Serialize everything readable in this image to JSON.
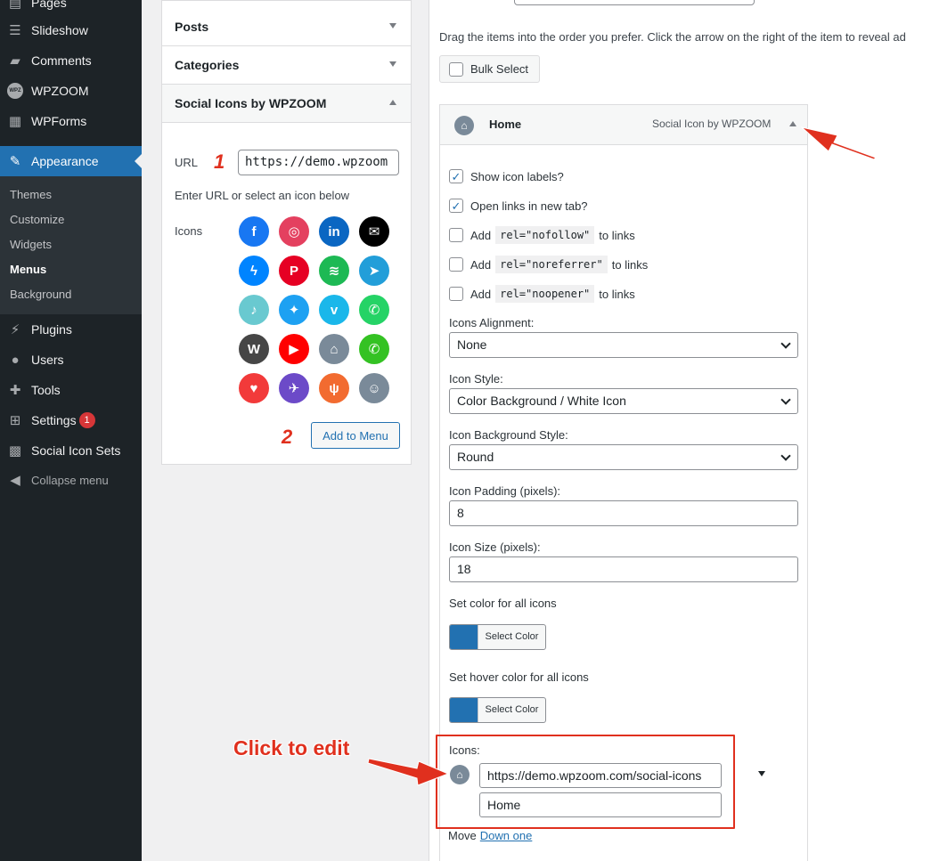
{
  "sidebar": {
    "items": [
      {
        "label": "Pages",
        "icon": "pages-icon"
      },
      {
        "label": "Slideshow",
        "icon": "slideshow-icon"
      },
      {
        "label": "Comments",
        "icon": "comments-icon"
      },
      {
        "label": "WPZOOM",
        "icon": "wpzoom-logo-icon"
      },
      {
        "label": "WPForms",
        "icon": "wpforms-icon"
      },
      {
        "label": "Appearance",
        "icon": "appearance-icon"
      },
      {
        "label": "Plugins",
        "icon": "plugins-icon"
      },
      {
        "label": "Users",
        "icon": "users-icon"
      },
      {
        "label": "Tools",
        "icon": "tools-icon"
      },
      {
        "label": "Settings",
        "icon": "settings-icon",
        "badge": "1"
      },
      {
        "label": "Social Icon Sets",
        "icon": "qr-icon"
      }
    ],
    "wpz_logo_text": "WPZ",
    "submenu": [
      "Themes",
      "Customize",
      "Widgets",
      "Menus",
      "Background"
    ],
    "collapse": "Collapse menu"
  },
  "left_panel": {
    "sections": [
      "Posts",
      "Categories",
      "Social Icons by WPZOOM"
    ],
    "url_label": "URL",
    "url_value": "https://demo.wpzoom",
    "hint": "Enter URL or select an icon below",
    "icons_label": "Icons",
    "add_button": "Add to Menu",
    "marker1": "1",
    "marker2": "2",
    "social_icons": [
      {
        "name": "facebook-icon",
        "color": "#1877f2",
        "glyph": "f"
      },
      {
        "name": "instagram-icon",
        "color": "#e4405f",
        "glyph": "◎"
      },
      {
        "name": "linkedin-icon",
        "color": "#0a66c2",
        "glyph": "in"
      },
      {
        "name": "mail-icon",
        "color": "#000000",
        "glyph": "✉"
      },
      {
        "name": "messenger-icon",
        "color": "#0084ff",
        "glyph": "ϟ"
      },
      {
        "name": "pinterest-icon",
        "color": "#e60023",
        "glyph": "P"
      },
      {
        "name": "spotify-icon",
        "color": "#1db954",
        "glyph": "≋"
      },
      {
        "name": "telegram-icon",
        "color": "#229ed9",
        "glyph": "➤"
      },
      {
        "name": "tiktok-icon",
        "color": "#69c9d0",
        "glyph": "♪"
      },
      {
        "name": "twitter-icon",
        "color": "#1da1f2",
        "glyph": "✦"
      },
      {
        "name": "vimeo-icon",
        "color": "#1ab7ea",
        "glyph": "v"
      },
      {
        "name": "whatsapp-icon",
        "color": "#25d366",
        "glyph": "✆"
      },
      {
        "name": "wordpress-icon",
        "color": "#464646",
        "glyph": "W"
      },
      {
        "name": "youtube-icon",
        "color": "#ff0000",
        "glyph": "▶"
      },
      {
        "name": "home-icon",
        "color": "#7a8a99",
        "glyph": "⌂"
      },
      {
        "name": "phone-icon",
        "color": "#34c223",
        "glyph": "✆"
      },
      {
        "name": "heart-icon",
        "color": "#f23a3a",
        "glyph": "♥"
      },
      {
        "name": "plane-icon",
        "color": "#6c4ac8",
        "glyph": "✈"
      },
      {
        "name": "restaurant-icon",
        "color": "#f26b30",
        "glyph": "ψ"
      },
      {
        "name": "user-circle-icon",
        "color": "#7a8a99",
        "glyph": "☺"
      }
    ]
  },
  "right_panel": {
    "instruction": "Drag the items into the order you prefer. Click the arrow on the right of the item to reveal ad",
    "bulk_select": "Bulk Select",
    "item_title": "Home",
    "item_type": "Social Icon by WPZOOM",
    "show_labels": "Show icon labels?",
    "open_new_tab": "Open links in new tab?",
    "add_word": "Add",
    "to_links": "to links",
    "rel_nofollow": "rel=\"nofollow\"",
    "rel_noreferrer": "rel=\"noreferrer\"",
    "rel_noopener": "rel=\"noopener\"",
    "align_label": "Icons Alignment:",
    "align_value": "None",
    "style_label": "Icon Style:",
    "style_value": "Color Background / White Icon",
    "bg_label": "Icon Background Style:",
    "bg_value": "Round",
    "padding_label": "Icon Padding (pixels):",
    "padding_value": "8",
    "size_label": "Icon Size (pixels):",
    "size_value": "18",
    "color_label": "Set color for all icons",
    "hover_label": "Set hover color for all icons",
    "select_color": "Select Color",
    "swatch_color": "#2271b1",
    "icons_label": "Icons:",
    "icon_url": "https://demo.wpzoom.com/social-icons",
    "icon_label_value": "Home",
    "move_label": "Move",
    "move_link": "Down one"
  },
  "annotations": {
    "callout": "Click to edit",
    "accent": "#e0301e"
  }
}
